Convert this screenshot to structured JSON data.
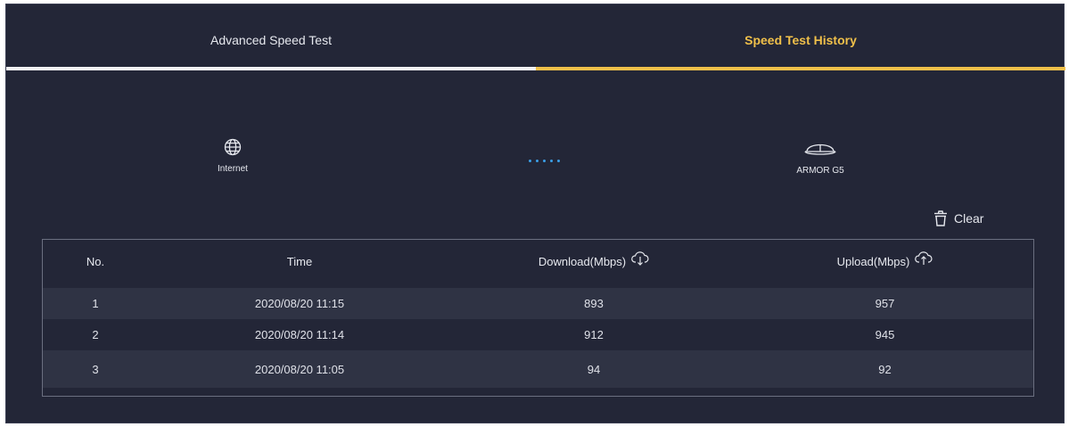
{
  "tabs": [
    {
      "label": "Advanced Speed Test",
      "active": false
    },
    {
      "label": "Speed Test History",
      "active": true
    }
  ],
  "topology": {
    "internet_label": "Internet",
    "device_label": "ARMOR G5"
  },
  "clear_label": "Clear",
  "table": {
    "headers": [
      "No.",
      "Time",
      "Download(Mbps)",
      "Upload(Mbps)"
    ],
    "rows": [
      {
        "no": "1",
        "time": "2020/08/20 11:15",
        "download": "893",
        "upload": "957"
      },
      {
        "no": "2",
        "time": "2020/08/20 11:14",
        "download": "912",
        "upload": "945"
      },
      {
        "no": "3",
        "time": "2020/08/20 11:05",
        "download": "94",
        "upload": "92"
      }
    ]
  },
  "colors": {
    "background": "#232637",
    "accent": "#f0c04a",
    "row_alt": "#2f3344",
    "dots": "#3b9fe8"
  },
  "icons": [
    "globe-icon",
    "router-icon",
    "trash-icon",
    "cloud-download-icon",
    "cloud-upload-icon"
  ]
}
